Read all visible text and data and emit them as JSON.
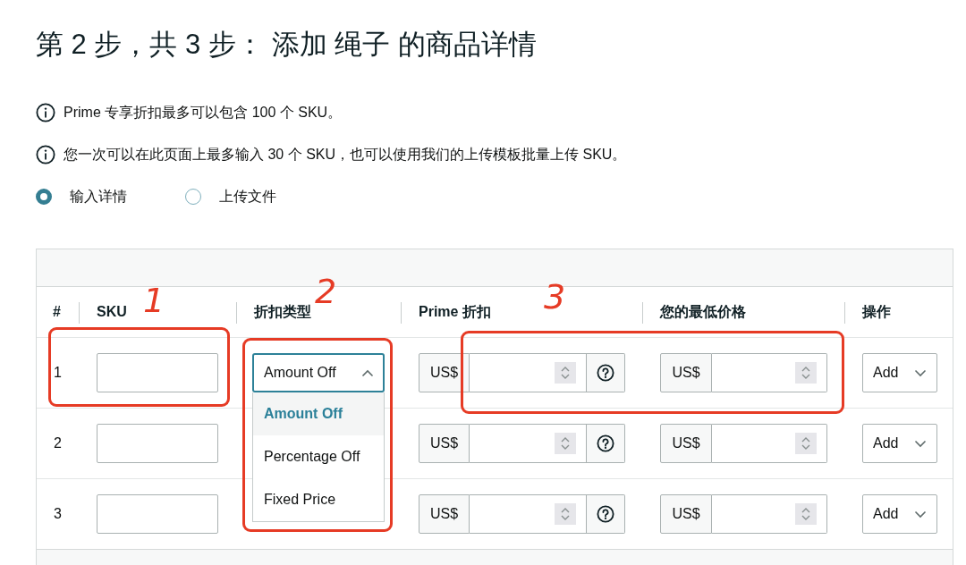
{
  "title": "第 2 步，共 3 步： 添加 绳子 的商品详情",
  "notices": [
    "Prime 专享折扣最多可以包含 100 个 SKU。",
    "您一次可以在此页面上最多输入 30 个 SKU，也可以使用我们的上传模板批量上传 SKU。"
  ],
  "entry_modes": [
    {
      "label": "输入详情",
      "selected": true
    },
    {
      "label": "上传文件",
      "selected": false
    }
  ],
  "table": {
    "columns": [
      "#",
      "SKU",
      "折扣类型",
      "Prime 折扣",
      "您的最低价格",
      "操作"
    ],
    "rows": [
      {
        "number": "1",
        "discount_type": {
          "value": "Amount Off",
          "expanded": true,
          "options": [
            {
              "label": "Amount Off",
              "selected": true
            },
            {
              "label": "Percentage Off",
              "selected": false
            },
            {
              "label": "Fixed Price",
              "selected": false
            }
          ]
        },
        "prime_discount_currency": "US$",
        "lowest_price_currency": "US$",
        "action": "Add"
      },
      {
        "number": "2",
        "prime_discount_currency": "US$",
        "lowest_price_currency": "US$",
        "action": "Add"
      },
      {
        "number": "3",
        "prime_discount_currency": "US$",
        "lowest_price_currency": "US$",
        "action": "Add"
      }
    ]
  },
  "annotations": [
    {
      "label": "1"
    },
    {
      "label": "2"
    },
    {
      "label": "3"
    }
  ]
}
